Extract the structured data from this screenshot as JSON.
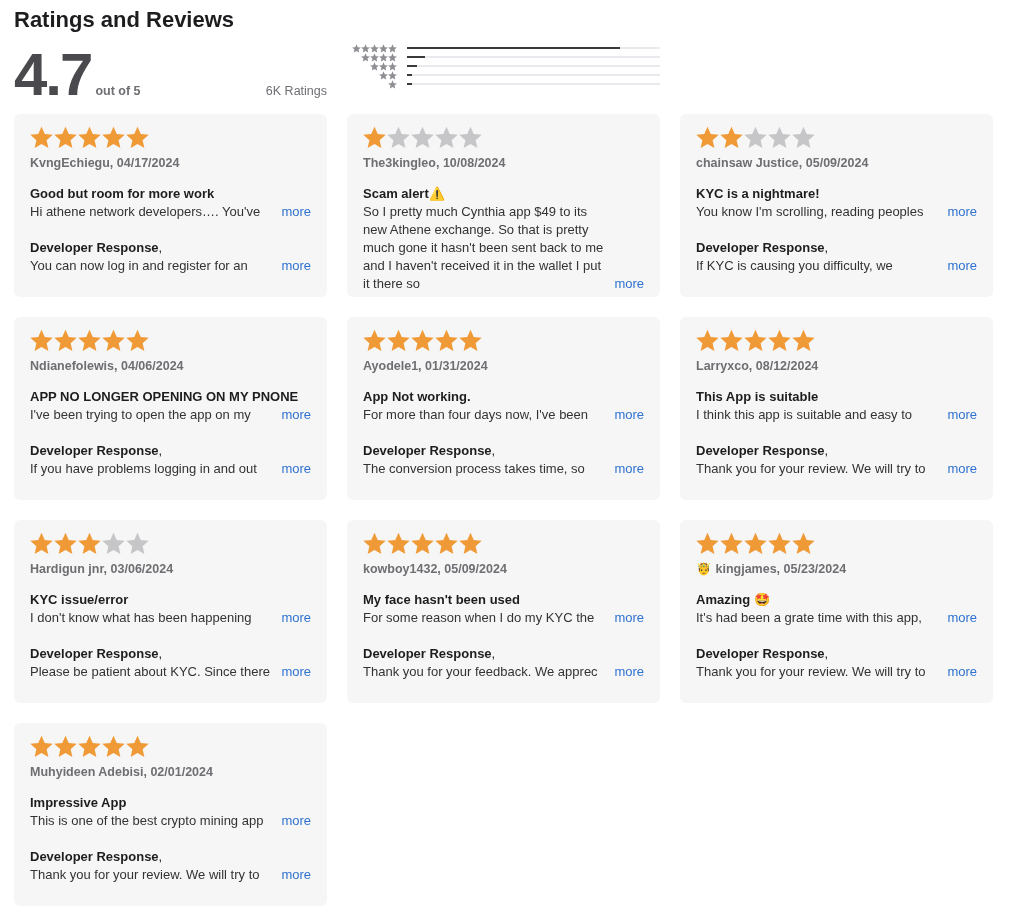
{
  "title": "Ratings and Reviews",
  "summary": {
    "score": "4.7",
    "out_of": "out of 5",
    "count": "6K Ratings"
  },
  "histogram": [
    {
      "level": 0.84
    },
    {
      "level": 0.07
    },
    {
      "level": 0.04
    },
    {
      "level": 0.02
    },
    {
      "level": 0.02
    }
  ],
  "reviews": [
    {
      "stars": 5,
      "author": "KvngEchiegu, 04/17/2024",
      "title": "Good but room for more work",
      "body": "Hi athene network developers…. You've",
      "more": "more",
      "response_heading": "**Developer Response**,",
      "response": "You can now log in and register for an",
      "response_more": "more"
    },
    {
      "stars": 1,
      "author": "The3kingleo, 10/08/2024",
      "title": "Scam alert⚠️",
      "body": "So I pretty much Cynthia app $49 to its new Athene exchange. So that is pretty much gone it hasn't been sent back to me and I haven't received it in the wallet I put it there so",
      "more": "more"
    },
    {
      "stars": 2,
      "author": "chainsaw Justice, 05/09/2024",
      "title": "KYC is a nightmare!",
      "body": "You know I'm scrolling, reading peoples",
      "more": "more",
      "response_heading": "**Developer Response**,",
      "response": "If KYC is causing you difficulty, we",
      "response_more": "more"
    },
    {
      "stars": 5,
      "author": "Ndianefolewis, 04/06/2024",
      "title": "APP NO LONGER OPENING ON MY PNONE",
      "body": "I've been trying to open the app on my",
      "more": "more",
      "response_heading": "**Developer Response**,",
      "response": "If you have problems logging in and out",
      "response_more": "more"
    },
    {
      "stars": 5,
      "author": "Ayodele1, 01/31/2024",
      "title": "App Not working.",
      "body": "For more than four days now, I've been",
      "more": "more",
      "response_heading": "**Developer Response**,",
      "response": "The conversion process takes time, so",
      "response_more": "more"
    },
    {
      "stars": 5,
      "author": "Larryxco, 08/12/2024",
      "title": "This App is suitable",
      "body": "I think this app is suitable and easy to",
      "more": "more",
      "response_heading": "**Developer Response**,",
      "response": "Thank you for your review. We will try to",
      "response_more": "more"
    },
    {
      "stars": 3,
      "author": "Hardigun jnr, 03/06/2024",
      "title": "KYC issue/error",
      "body": "I don't know what has been happening",
      "more": "more",
      "response_heading": "**Developer Response**,",
      "response": "Please be patient about KYC. Since there",
      "response_more": "more"
    },
    {
      "stars": 5,
      "author": "kowboy1432, 05/09/2024",
      "title": "My face hasn't been used",
      "body": "For some reason when I do my KYC the",
      "more": "more",
      "response_heading": "**Developer Response**,",
      "response": "Thank you for your feedback. We apprec",
      "response_more": "more"
    },
    {
      "stars": 5,
      "author": "🤴 kingjames, 05/23/2024",
      "title": "Amazing 🤩",
      "body": "It's had been a grate time with this app,",
      "more": "more",
      "response_heading": "**Developer Response**,",
      "response": "Thank you for your review. We will try to",
      "response_more": "more"
    },
    {
      "stars": 5,
      "author": "Muhyideen Adebisi, 02/01/2024",
      "title": "Impressive App",
      "body": "This is one of the best crypto mining app",
      "more": "more",
      "response_heading": "**Developer Response**,",
      "response": "Thank you for your review. We will try to",
      "response_more": "more"
    }
  ]
}
